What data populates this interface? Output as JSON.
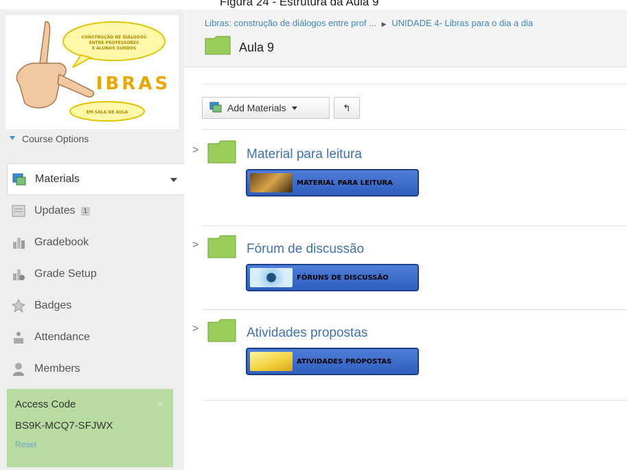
{
  "caption": "Figura 24 - Estrutura da Aula 9",
  "logo": {
    "bubble_top": "CONSTRUÇÃO DE DIÁLOGOS ENTRE PROFESSORES E ALUNOS SURDOS",
    "letters": "IBRAS",
    "bubble_bottom": "EM SALA DE AULA"
  },
  "sidebar": {
    "course_options": "Course Options",
    "items": [
      {
        "label": "Materials",
        "icon": "materials-icon",
        "active": true
      },
      {
        "label": "Updates",
        "icon": "updates-icon",
        "count": "1"
      },
      {
        "label": "Gradebook",
        "icon": "gradebook-icon"
      },
      {
        "label": "Grade Setup",
        "icon": "grade-setup-icon"
      },
      {
        "label": "Badges",
        "icon": "badges-icon"
      },
      {
        "label": "Attendance",
        "icon": "attendance-icon"
      },
      {
        "label": "Members",
        "icon": "members-icon"
      }
    ],
    "access": {
      "title": "Access Code",
      "code": "BS9K-MCQ7-SFJWX",
      "reset": "Reset",
      "close": "×"
    }
  },
  "header": {
    "breadcrumb_1": "Libras: construção de diálogos entre prof ...",
    "breadcrumb_sep": "▶",
    "breadcrumb_2": "UNIDADE 4- Libras para o dia a dia",
    "title": "Aula 9"
  },
  "toolbar": {
    "add_label": "Add Materials",
    "undo_glyph": "↰"
  },
  "folders": [
    {
      "name": "Material para leitura",
      "banner": "MATERIAL PARA LEITURA",
      "chevron": ">"
    },
    {
      "name": "Fórum de discussão",
      "banner": "FÓRUNS DE DISCUSSÃO",
      "chevron": ">"
    },
    {
      "name": "Atividades propostas",
      "banner": "ATIVIDADES PROPOSTAS",
      "chevron": ">"
    }
  ],
  "colors": {
    "accent": "#3d72b7",
    "access_bg": "#b7dba1",
    "folder_green": "#9acd5a",
    "banner_blue": "#3a6ccc"
  }
}
